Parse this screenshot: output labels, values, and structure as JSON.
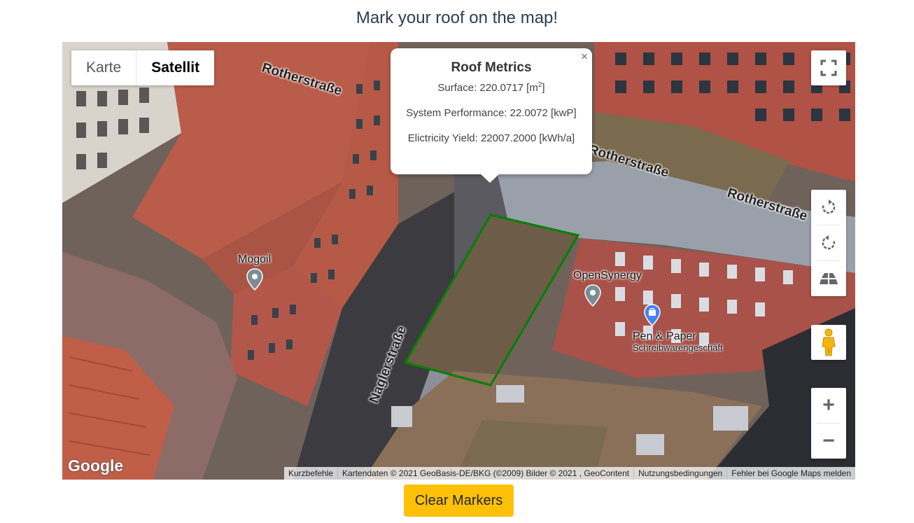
{
  "page": {
    "title": "Mark your roof on the map!"
  },
  "map_type": {
    "options": [
      "Karte",
      "Satellit"
    ],
    "selected": "Satellit"
  },
  "streets": [
    "Rotherstraße",
    "Rotherstraße",
    "Rotherstraße",
    "Naglerstraße"
  ],
  "pois": [
    {
      "name": "Mogoil",
      "subtitle": ""
    },
    {
      "name": "OpenSynergy",
      "subtitle": ""
    },
    {
      "name": "Pen & Paper",
      "subtitle": "Schreibwarengeschäft"
    }
  ],
  "popup": {
    "title": "Roof Metrics",
    "surface_label": "Surface: 220.0717 [m",
    "surface_sup": "2",
    "surface_end": "]",
    "performance": "System Performance: 22.0072 [kwP]",
    "yield": "Elictricity Yield: 22007.2000 [kWh/a]",
    "close": "×"
  },
  "attribution": [
    "Kurzbefehle",
    "Kartendaten © 2021 GeoBasis-DE/BKG (©2009) Bilder © 2021 , GeoContent",
    "Nutzungsbedingungen",
    "Fehler bei Google Maps melden"
  ],
  "google_logo": "Google",
  "controls": {
    "icons": [
      "fullscreen-icon",
      "rotate-cw-icon",
      "rotate-ccw-icon",
      "tilt-icon",
      "pegman-icon",
      "zoom-in-icon",
      "zoom-out-icon"
    ],
    "zoom_in": "+",
    "zoom_out": "−"
  },
  "polygon_color": "#008000",
  "accent_button_color": "#ffc107",
  "clear_button": {
    "label": "Clear Markers"
  }
}
